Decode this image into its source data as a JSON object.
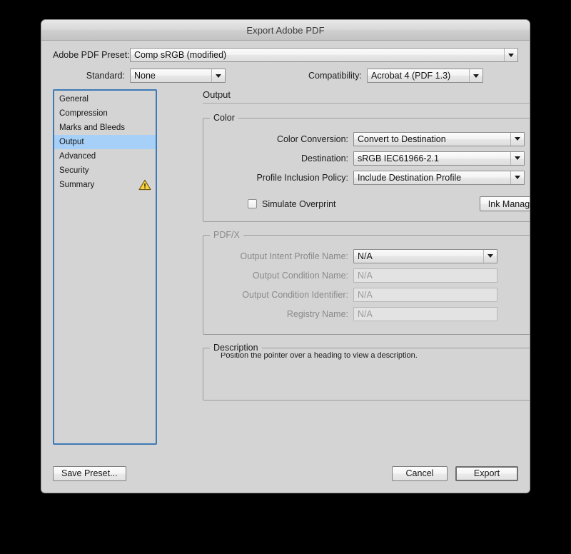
{
  "window": {
    "title": "Export Adobe PDF"
  },
  "top": {
    "preset_label": "Adobe PDF Preset:",
    "preset_value": "Comp sRGB (modified)",
    "standard_label": "Standard:",
    "standard_value": "None",
    "compatibility_label": "Compatibility:",
    "compatibility_value": "Acrobat 4 (PDF 1.3)"
  },
  "sidebar": {
    "items": [
      {
        "label": "General",
        "selected": false,
        "warning": false
      },
      {
        "label": "Compression",
        "selected": false,
        "warning": false
      },
      {
        "label": "Marks and Bleeds",
        "selected": false,
        "warning": false
      },
      {
        "label": "Output",
        "selected": true,
        "warning": false
      },
      {
        "label": "Advanced",
        "selected": false,
        "warning": false
      },
      {
        "label": "Security",
        "selected": false,
        "warning": false
      },
      {
        "label": "Summary",
        "selected": false,
        "warning": true
      }
    ],
    "warning_icon": "warning-triangle-icon",
    "selection_color": "#a6d0f7",
    "focus_border_color": "#3d7ab5"
  },
  "pane": {
    "title": "Output",
    "color_group": {
      "legend": "Color",
      "color_conversion_label": "Color Conversion:",
      "color_conversion_value": "Convert to Destination",
      "destination_label": "Destination:",
      "destination_value": "sRGB IEC61966-2.1",
      "profile_policy_label": "Profile Inclusion Policy:",
      "profile_policy_value": "Include Destination Profile",
      "simulate_overprint_label": "Simulate Overprint",
      "simulate_overprint_checked": false,
      "ink_manager_label": "Ink Manager..."
    },
    "pdfx_group": {
      "legend": "PDF/X",
      "enabled": false,
      "output_intent_label": "Output Intent Profile Name:",
      "output_intent_value": "N/A",
      "condition_name_label": "Output Condition Name:",
      "condition_name_value": "N/A",
      "condition_id_label": "Output Condition Identifier:",
      "condition_id_value": "N/A",
      "registry_label": "Registry Name:",
      "registry_value": "N/A"
    },
    "description_group": {
      "legend": "Description",
      "text": "Position the pointer over a heading to view a description."
    }
  },
  "footer": {
    "save_preset_label": "Save Preset...",
    "cancel_label": "Cancel",
    "export_label": "Export"
  }
}
